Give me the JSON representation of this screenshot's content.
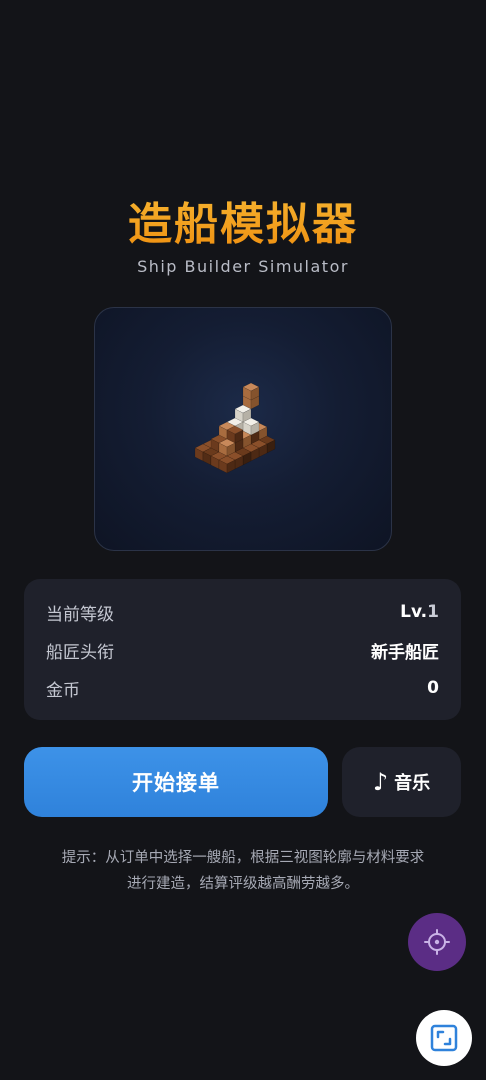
{
  "header": {
    "title": "造船模拟器",
    "subtitle": "Ship Builder Simulator"
  },
  "stats": {
    "level_label": "当前等级",
    "level_prefix": "Lv.",
    "level_value": "1",
    "rank_label": "船匠头衔",
    "rank_value": "新手船匠",
    "gold_label": "金币",
    "gold_value": "0"
  },
  "actions": {
    "start_label": "开始接单",
    "music_icon": "♪",
    "music_label": "音乐"
  },
  "hint": {
    "line1": "提示：从订单中选择一艘船，根据三视图轮廓与材料要求",
    "line2": "进行建造，结算评级越高酬劳越多。"
  },
  "icons": {
    "settings": "crosshair-icon",
    "corner": "frame-icon"
  },
  "colors": {
    "title": "#f0a020",
    "primary": "#3089df",
    "settings_fab": "#5b2d85",
    "panel": "#1f212b",
    "background": "#131418"
  }
}
